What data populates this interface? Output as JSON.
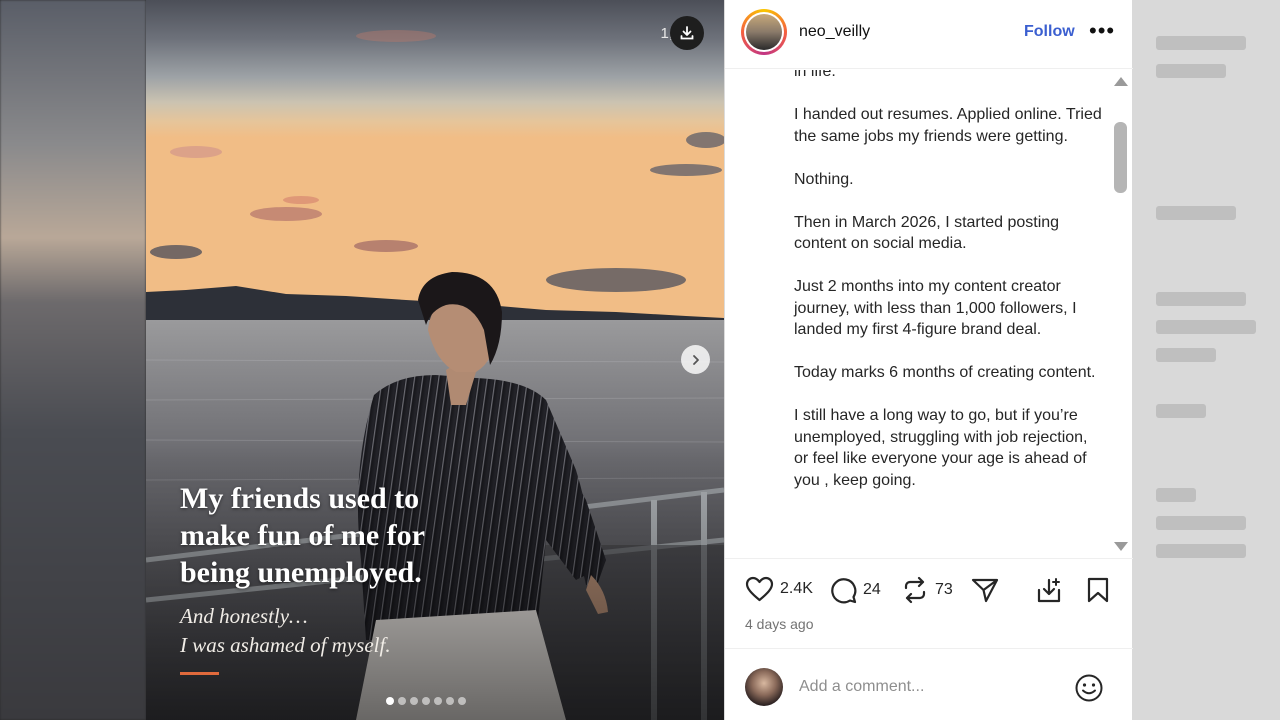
{
  "post": {
    "media_count_label": "1,",
    "overlay_title": "My friends used to make fun of me for being unemployed.",
    "overlay_sub_line1": "And honestly…",
    "overlay_sub_line2": "I was ashamed of myself.",
    "carousel": {
      "total": 7,
      "active_index": 0
    }
  },
  "header": {
    "username": "neo_veilly",
    "follow_label": "Follow",
    "more_label": "•••"
  },
  "caption": {
    "paragraphs": [
      "in life.",
      "I handed out resumes. Applied online. Tried the same jobs my friends were getting.",
      "Nothing.",
      "Then in March 2026, I started posting content on social media.",
      "Just 2 months into my content creator journey, with less than 1,000 followers, I landed my first 4-figure brand deal.",
      "Today marks 6 months of creating content.",
      "I still have a long way to go, but if you’re unemployed, struggling with job rejection, or feel like everyone your age is ahead of you , keep going."
    ]
  },
  "actions": {
    "likes": "2.4K",
    "comments": "24",
    "reposts": "73",
    "timestamp": "4 days ago"
  },
  "comment_box": {
    "placeholder": "Add a comment..."
  },
  "colors": {
    "follow": "#3b5fd0",
    "accent_bar": "#e06a3c"
  },
  "icons": [
    "download-icon",
    "chevron-right-icon",
    "more-icon",
    "heart-icon",
    "comment-icon",
    "repost-icon",
    "share-icon",
    "save-to-icon",
    "bookmark-icon",
    "emoji-icon"
  ]
}
